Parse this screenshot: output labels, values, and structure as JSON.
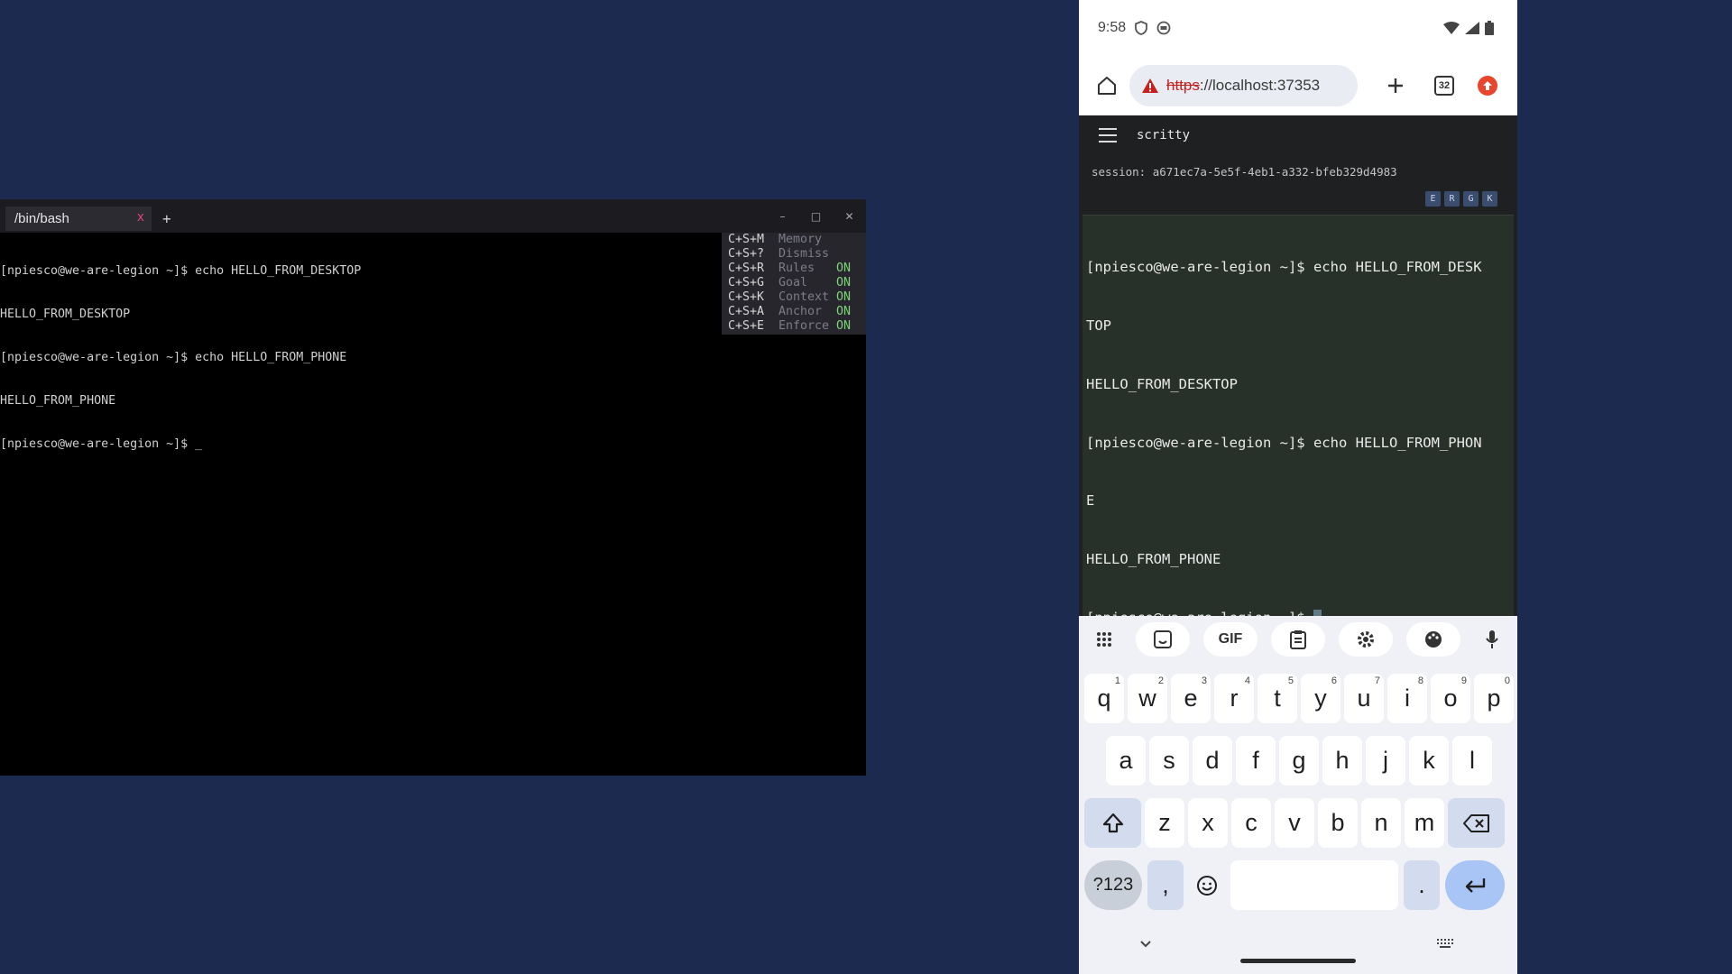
{
  "desktop_terminal": {
    "tab_title": "/bin/bash",
    "tab_close": "x",
    "tab_add": "+",
    "controls": {
      "minimize": "–",
      "maximize": "□",
      "close": "✕"
    },
    "lines": [
      "[npiesco@we-are-legion ~]$ echo HELLO_FROM_DESKTOP",
      "HELLO_FROM_DESKTOP",
      "[npiesco@we-are-legion ~]$ echo HELLO_FROM_PHONE",
      "HELLO_FROM_PHONE",
      "[npiesco@we-are-legion ~]$ _"
    ],
    "shortcuts": [
      {
        "key": "C+S+M",
        "label": "Memory",
        "state": ""
      },
      {
        "key": "C+S+?",
        "label": "Dismiss",
        "state": ""
      },
      {
        "key": "C+S+R",
        "label": "Rules",
        "state": "ON"
      },
      {
        "key": "C+S+G",
        "label": "Goal",
        "state": "ON"
      },
      {
        "key": "C+S+K",
        "label": "Context",
        "state": "ON"
      },
      {
        "key": "C+S+A",
        "label": "Anchor",
        "state": "ON"
      },
      {
        "key": "C+S+E",
        "label": "Enforce",
        "state": "ON"
      }
    ]
  },
  "phone": {
    "status": {
      "time": "9:58"
    },
    "browser": {
      "url_scheme": "https",
      "url_rest": "://localhost:37353",
      "tab_count": "32"
    },
    "app": {
      "title": "scritty",
      "session": "session: a671ec7a-5e5f-4eb1-a332-bfeb329d4983",
      "modes": [
        "E",
        "R",
        "G",
        "K"
      ],
      "lines": [
        "[npiesco@we-are-legion ~]$ echo HELLO_FROM_DESK",
        "TOP",
        "HELLO_FROM_DESKTOP",
        "[npiesco@we-are-legion ~]$ echo HELLO_FROM_PHON",
        "E",
        "HELLO_FROM_PHONE",
        "[npiesco@we-are-legion ~]$ "
      ]
    },
    "keyboard": {
      "gif_label": "GIF",
      "row1": [
        "q",
        "w",
        "e",
        "r",
        "t",
        "y",
        "u",
        "i",
        "o",
        "p"
      ],
      "row1_hints": [
        "1",
        "2",
        "3",
        "4",
        "5",
        "6",
        "7",
        "8",
        "9",
        "0"
      ],
      "row2": [
        "a",
        "s",
        "d",
        "f",
        "g",
        "h",
        "j",
        "k",
        "l"
      ],
      "row3": [
        "z",
        "x",
        "c",
        "v",
        "b",
        "n",
        "m"
      ],
      "sym_label": "?123",
      "comma": ",",
      "period": "."
    }
  }
}
